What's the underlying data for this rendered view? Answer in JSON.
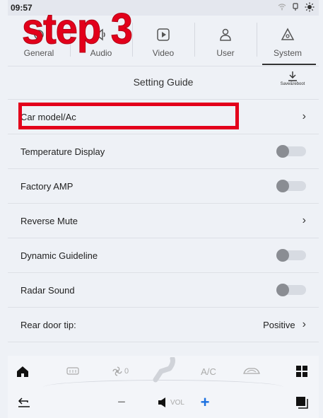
{
  "status": {
    "time": "09:57"
  },
  "overlay": {
    "step_label": "step 3"
  },
  "tabs": [
    {
      "label": "General",
      "icon": "gear-icon"
    },
    {
      "label": "Audio",
      "icon": "speaker-icon"
    },
    {
      "label": "Video",
      "icon": "play-icon"
    },
    {
      "label": "User",
      "icon": "user-icon"
    },
    {
      "label": "System",
      "icon": "system-gear-icon"
    }
  ],
  "guide": {
    "title": "Setting Guide",
    "save_label": "Save&reboot"
  },
  "settings": [
    {
      "label": "Car model/Ac",
      "control": "chevron"
    },
    {
      "label": "Temperature Display",
      "control": "toggle",
      "on": false
    },
    {
      "label": "Factory AMP",
      "control": "toggle",
      "on": false
    },
    {
      "label": "Reverse Mute",
      "control": "chevron"
    },
    {
      "label": "Dynamic Guideline",
      "control": "toggle",
      "on": false
    },
    {
      "label": "Radar Sound",
      "control": "toggle",
      "on": false
    },
    {
      "label": "Rear door tip:",
      "control": "value-chevron",
      "value": "Positive"
    }
  ],
  "bottom": {
    "fan_level": "0",
    "ac_label": "A/C",
    "vol_label": "VOL",
    "minus": "−",
    "plus": "+"
  },
  "colors": {
    "highlight": "#e3001b",
    "accent_blue": "#1a6fe0"
  }
}
